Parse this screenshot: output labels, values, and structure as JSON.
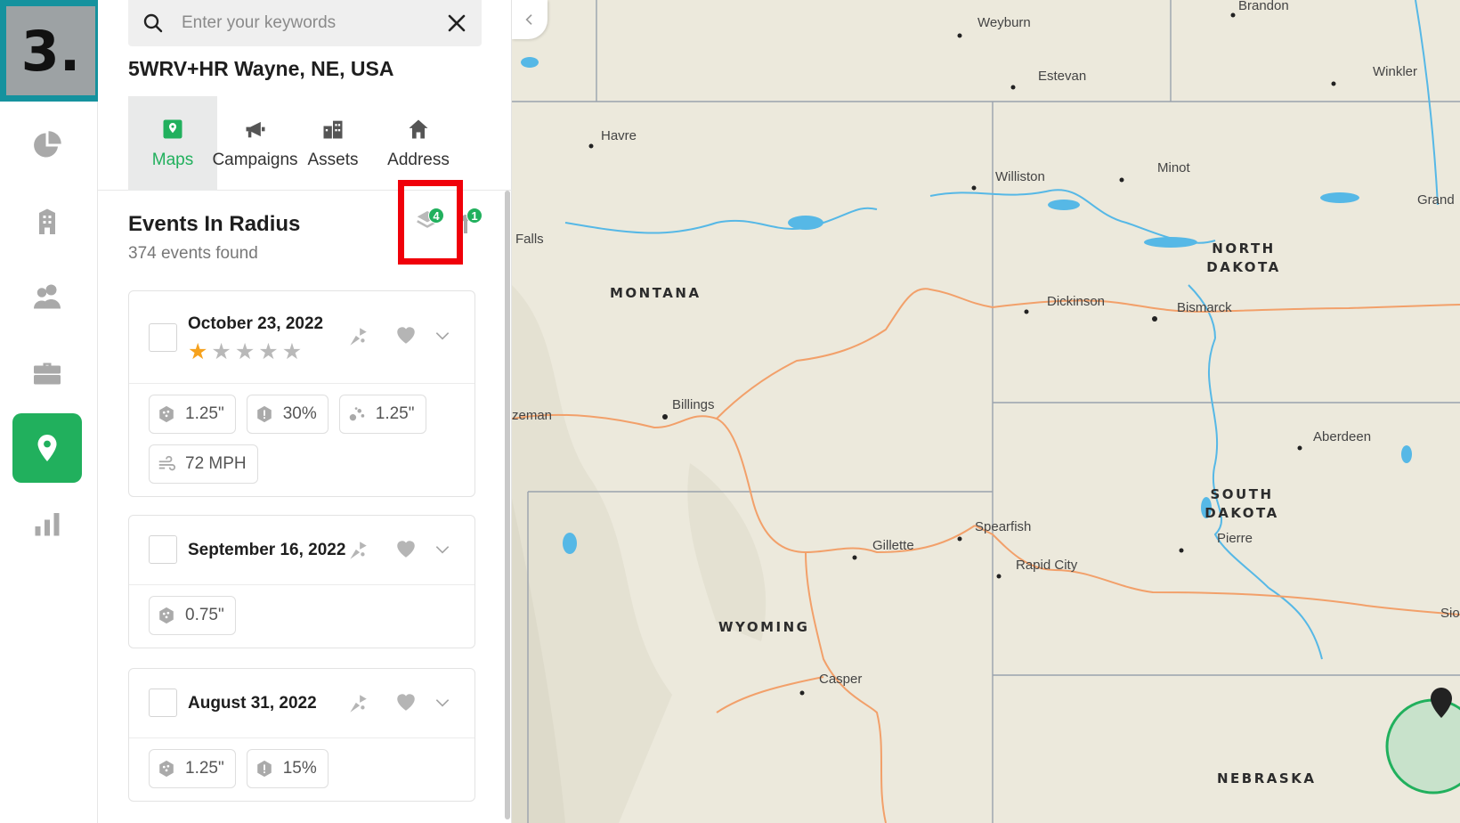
{
  "step_badge": "3.",
  "rail": {
    "items": [
      {
        "icon": "pie-chart-icon",
        "active": false
      },
      {
        "icon": "building-icon",
        "active": false
      },
      {
        "icon": "users-icon",
        "active": false
      },
      {
        "icon": "briefcase-icon",
        "active": false
      },
      {
        "icon": "map-pin-icon",
        "active": true
      },
      {
        "icon": "bar-chart-icon",
        "active": false
      }
    ]
  },
  "search": {
    "placeholder": "Enter your keywords",
    "value": ""
  },
  "address": "5WRV+HR Wayne, NE, USA",
  "tabs": [
    {
      "label": "Maps",
      "icon": "map-icon",
      "active": true
    },
    {
      "label": "Campaigns",
      "icon": "megaphone-icon",
      "active": false
    },
    {
      "label": "Assets",
      "icon": "buildings-icon",
      "active": false
    },
    {
      "label": "Address",
      "icon": "home-icon",
      "active": false
    }
  ],
  "events": {
    "title": "Events In Radius",
    "count_text": "374 events found",
    "layers_badge": "4",
    "marker_badge": "1",
    "cards": [
      {
        "date": "October 23, 2022",
        "rating": 1,
        "rating_max": 5,
        "chips": [
          {
            "icon": "hail-icon",
            "value": "1.25\""
          },
          {
            "icon": "probability-icon",
            "value": "30%"
          },
          {
            "icon": "hail-scatter-icon",
            "value": "1.25\""
          },
          {
            "icon": "wind-icon",
            "value": "72 MPH"
          }
        ]
      },
      {
        "date": "September 16, 2022",
        "chips": [
          {
            "icon": "hail-icon",
            "value": "0.75\""
          }
        ]
      },
      {
        "date": "August 31, 2022",
        "chips": [
          {
            "icon": "hail-icon",
            "value": "1.25\""
          },
          {
            "icon": "probability-icon",
            "value": "15%"
          }
        ]
      }
    ]
  },
  "map": {
    "states": [
      "MONTANA",
      "NORTH DAKOTA",
      "SOUTH DAKOTA",
      "WYOMING",
      "NEBRASKA"
    ],
    "cities": [
      "Brandon",
      "Weyburn",
      "Estevan",
      "Winkler",
      "Havre",
      "Williston",
      "Minot",
      "Grand",
      "Falls",
      "Dickinson",
      "Bismarck",
      "Billings",
      "zeman",
      "Aberdeen",
      "Spearfish",
      "Gillette",
      "Rapid City",
      "Pierre",
      "Casper",
      "Sio"
    ],
    "colors": {
      "land": "#ece9dc",
      "water": "#56b8e6",
      "roads": "#f2a06a",
      "borders": "#9aa2ad",
      "radius": "#21b05d"
    }
  },
  "colors": {
    "accent": "#21b05d",
    "badge_teal": "#15929e",
    "highlight": "#f0000a",
    "star": "#f6a21e"
  }
}
